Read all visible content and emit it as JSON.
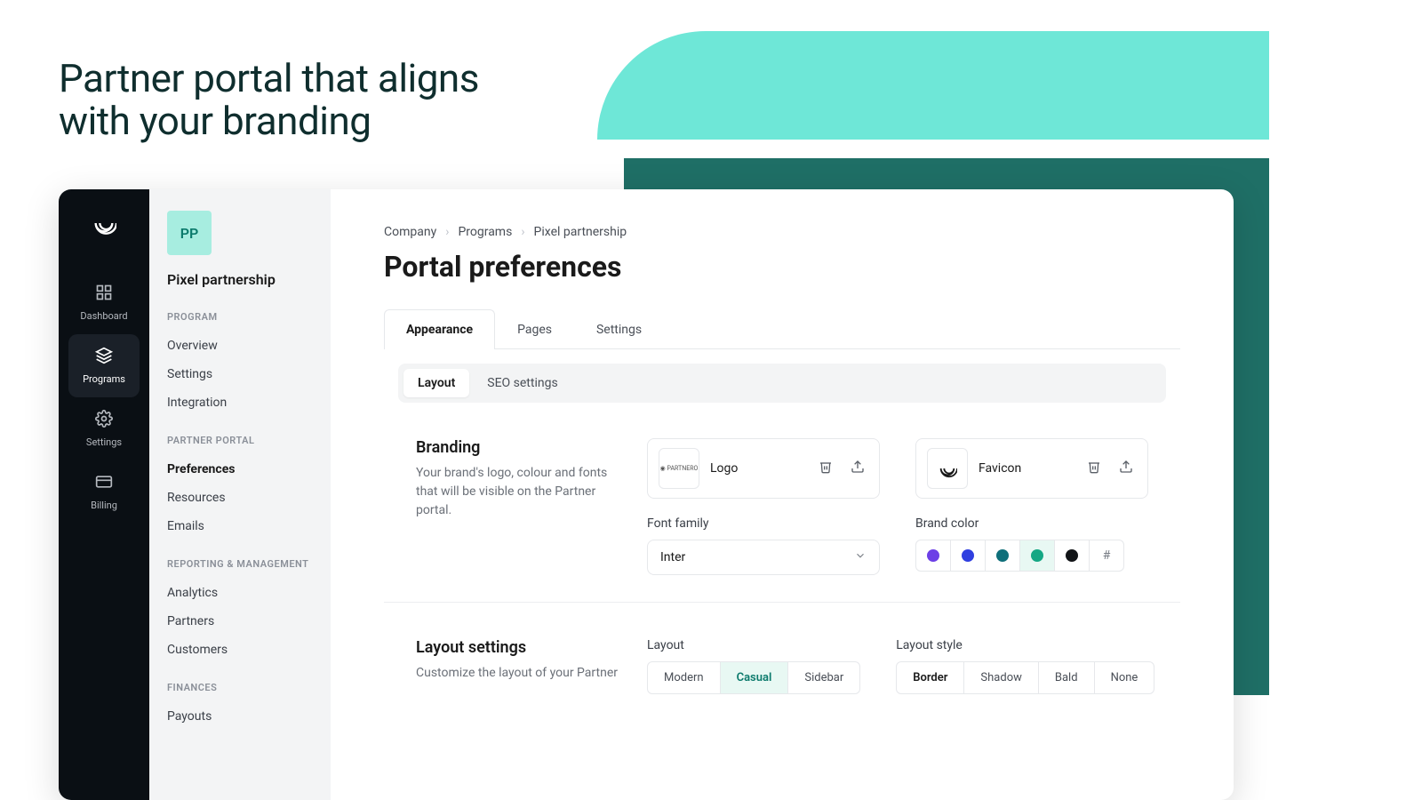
{
  "hero": {
    "title": "Partner portal that aligns with your branding"
  },
  "nav": {
    "items": [
      {
        "label": "Dashboard",
        "icon": "dashboard"
      },
      {
        "label": "Programs",
        "icon": "layers"
      },
      {
        "label": "Settings",
        "icon": "gear"
      },
      {
        "label": "Billing",
        "icon": "card"
      }
    ],
    "active": 1
  },
  "sidebar": {
    "org_initials": "PP",
    "org_name": "Pixel partnership",
    "sections": [
      {
        "heading": "PROGRAM",
        "links": [
          "Overview",
          "Settings",
          "Integration"
        ]
      },
      {
        "heading": "PARTNER PORTAL",
        "links": [
          "Preferences",
          "Resources",
          "Emails"
        ],
        "active": 0
      },
      {
        "heading": "REPORTING & MANAGEMENT",
        "links": [
          "Analytics",
          "Partners",
          "Customers"
        ]
      },
      {
        "heading": "FINANCES",
        "links": [
          "Payouts"
        ]
      }
    ]
  },
  "breadcrumb": [
    "Company",
    "Programs",
    "Pixel partnership"
  ],
  "page_title": "Portal preferences",
  "tabs": {
    "items": [
      "Appearance",
      "Pages",
      "Settings"
    ],
    "active": 0
  },
  "subtabs": {
    "items": [
      "Layout",
      "SEO settings"
    ],
    "active": 0
  },
  "branding": {
    "title": "Branding",
    "desc": "Your brand's logo, colour and fonts that will be visible on the Partner portal.",
    "logo_label": "Logo",
    "favicon_label": "Favicon",
    "font_label": "Font family",
    "font_value": "Inter",
    "brand_color_label": "Brand color",
    "colors": [
      "#6c3fe6",
      "#2f3fe0",
      "#0f6f7a",
      "#14a784",
      "#121417"
    ],
    "active_color": 3,
    "custom_swatch": "#"
  },
  "layout": {
    "title": "Layout settings",
    "desc": "Customize the layout of your Partner",
    "layout_label": "Layout",
    "layout_options": [
      "Modern",
      "Casual",
      "Sidebar"
    ],
    "layout_active": 1,
    "style_label": "Layout style",
    "style_options": [
      "Border",
      "Shadow",
      "Bald",
      "None"
    ],
    "style_active": 0
  },
  "thumb_logo_text": "◉ PARTNERO"
}
